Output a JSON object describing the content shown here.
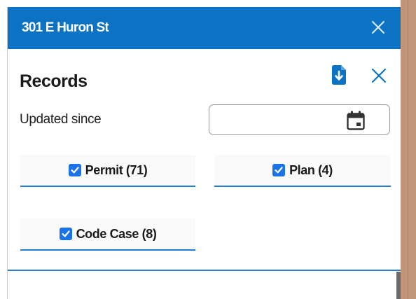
{
  "header": {
    "title": "301 E Huron St",
    "close_icon": "close-icon"
  },
  "records": {
    "title": "Records",
    "export_icon": "file-download-icon",
    "close_icon": "close-icon"
  },
  "filters": {
    "updated_since_label": "Updated since",
    "date_value": "",
    "date_placeholder": "",
    "calendar_icon": "calendar-icon",
    "permit": {
      "label": "Permit (71)",
      "checked": true
    },
    "plan": {
      "label": "Plan (4)",
      "checked": true
    },
    "code_case": {
      "label": "Code Case (8)",
      "checked": true
    }
  },
  "colors": {
    "header_bg": "#0b72c4",
    "accent": "#1f7fd1",
    "checkbox": "#1a73e8",
    "side_bg": "#c29478"
  }
}
